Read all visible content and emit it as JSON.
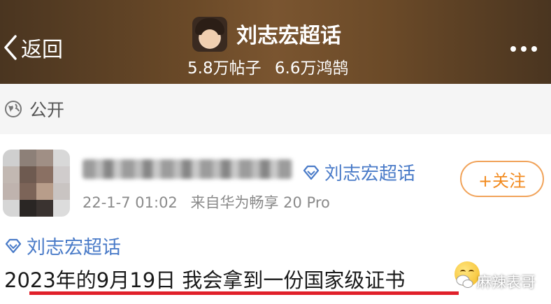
{
  "header": {
    "back_label": "返回",
    "title": "刘志宏超话",
    "posts_stat": "5.8万帖子",
    "members_stat": "6.6万鸿鹄"
  },
  "visibility": {
    "label": "公开"
  },
  "post": {
    "tag_label": "刘志宏超话",
    "date": "22-1-7 01:02",
    "source": "来自华为畅享 20 Pro",
    "follow_label": "+关注",
    "body_tag": "刘志宏超话",
    "text": "2023年的9月19日 我会拿到一份国家级证书"
  },
  "watermark": {
    "text": "麻辣表哥"
  },
  "colors": {
    "link_blue": "#4a7bc8",
    "follow_orange": "#f28a1e",
    "underline_red": "#e0202a",
    "header_brown": "#6b4a28"
  }
}
